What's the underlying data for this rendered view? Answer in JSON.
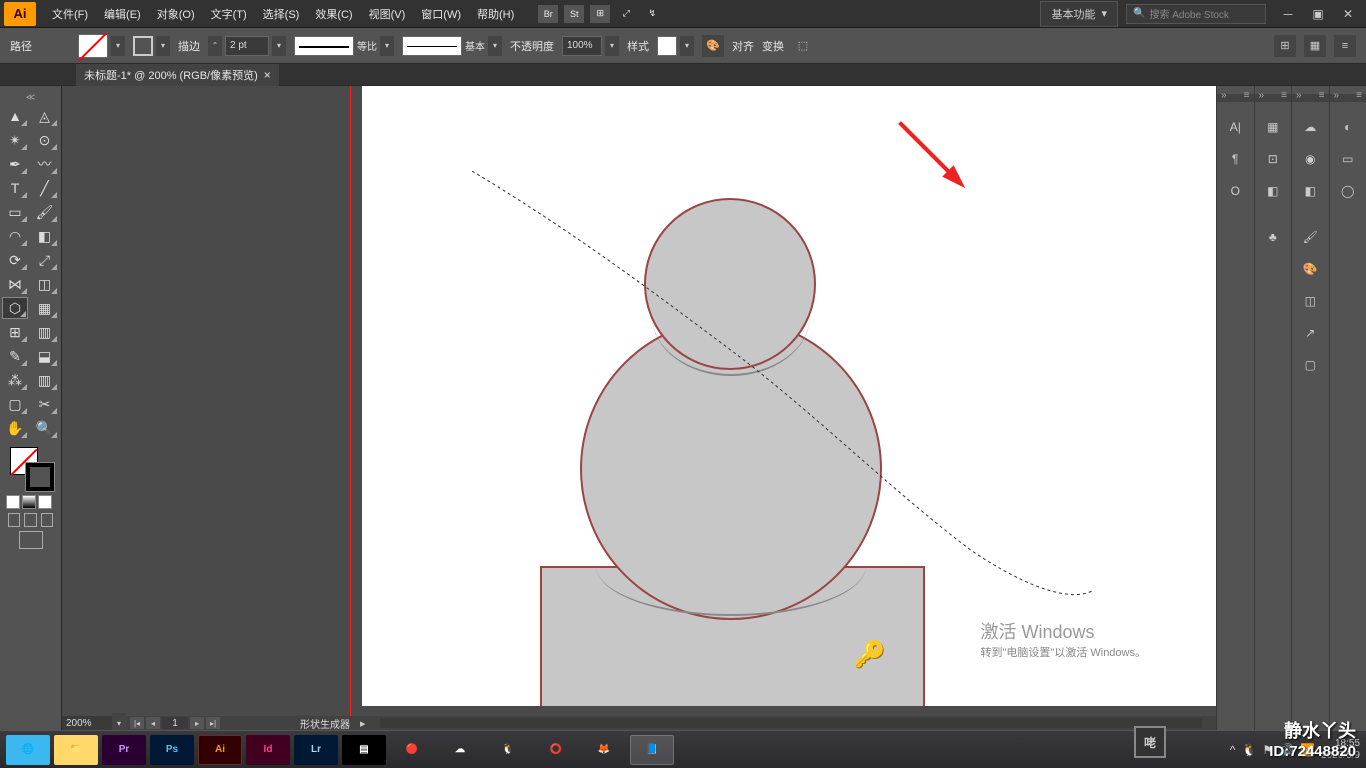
{
  "menubar": {
    "logo": "Ai",
    "items": [
      "文件(F)",
      "编辑(E)",
      "对象(O)",
      "文字(T)",
      "选择(S)",
      "效果(C)",
      "视图(V)",
      "窗口(W)",
      "帮助(H)"
    ],
    "icon_labels": [
      "Br",
      "St"
    ],
    "workspace": "基本功能",
    "search_placeholder": "搜索 Adobe Stock"
  },
  "control_bar": {
    "mode_label": "路径",
    "stroke_label": "描边",
    "stroke_width": "2 pt",
    "profile_label": "等比",
    "brush_label": "基本",
    "opacity_label": "不透明度",
    "opacity_value": "100%",
    "style_label": "样式",
    "align_label": "对齐",
    "transform_label": "变换"
  },
  "doc_tab": {
    "title": "未标题-1* @ 200% (RGB/像素预览)"
  },
  "status": {
    "zoom": "200%",
    "artboard": "1",
    "tool": "形状生成器"
  },
  "activate": {
    "title": "激活 Windows",
    "subtitle": "转到\"电脑设置\"以激活 Windows。"
  },
  "watermark": {
    "line1": "静水丫头",
    "line2": "ID:72448820"
  },
  "taskbar": {
    "time": "18:55",
    "date": "2020/5/9",
    "apps": [
      "🌐",
      "📁",
      "Pr",
      "Ps",
      "Ai",
      "Id",
      "Lr",
      "▤",
      "🔴",
      "☁",
      "🐧",
      "⭕",
      "🦊",
      "📘"
    ]
  },
  "colors": {
    "accent": "#ff9a00",
    "shape_fill": "#c7c7c7",
    "shape_stroke": "#9b4444",
    "arrow": "#ee2222"
  }
}
